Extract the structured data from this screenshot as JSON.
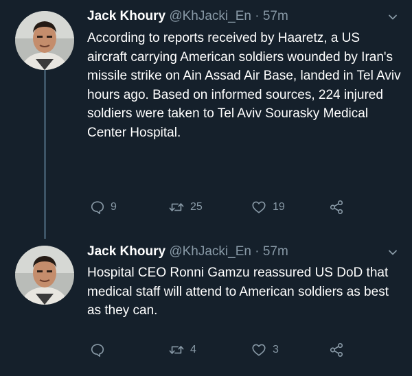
{
  "theme": {
    "background": "#15202b",
    "text": "#ffffff",
    "secondary_text": "#8899a6",
    "thread_line": "#3d5466"
  },
  "tweets": [
    {
      "author": {
        "name": "Jack Khoury",
        "handle": "@KhJacki_En",
        "avatar_icon": "profile-photo"
      },
      "separator": "·",
      "time": "57m",
      "text": "According to reports received by Haaretz, a US aircraft carrying American soldiers wounded by Iran's missile strike on Ain Assad Air Base, landed in Tel Aviv hours ago. Based on informed sources, 224 injured soldiers were taken to Tel Aviv Sourasky Medical Center Hospital.",
      "actions": {
        "replies": "9",
        "retweets": "25",
        "likes": "19"
      }
    },
    {
      "author": {
        "name": "Jack Khoury",
        "handle": "@KhJacki_En",
        "avatar_icon": "profile-photo"
      },
      "separator": "·",
      "time": "57m",
      "text": "Hospital CEO Ronni Gamzu reassured US DoD that medical staff will attend to American soldiers as best as they can.",
      "actions": {
        "replies": "",
        "retweets": "4",
        "likes": "3"
      }
    }
  ]
}
